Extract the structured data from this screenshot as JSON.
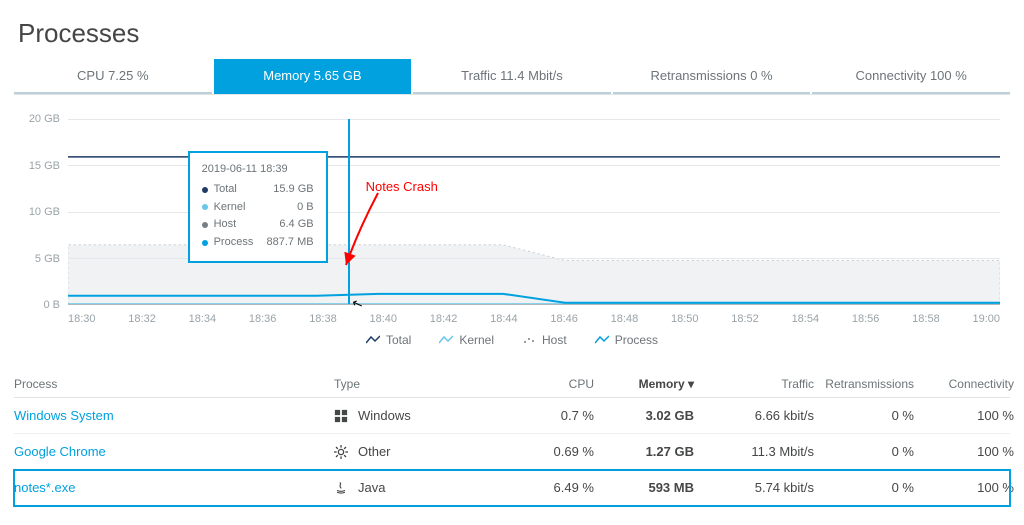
{
  "title": "Processes",
  "tabs": [
    {
      "label": "CPU 7.25 %"
    },
    {
      "label": "Memory 5.65 GB"
    },
    {
      "label": "Traffic 11.4 Mbit/s"
    },
    {
      "label": "Retransmissions 0 %"
    },
    {
      "label": "Connectivity 100 %"
    }
  ],
  "active_tab": 1,
  "chart_data": {
    "type": "line",
    "title": "",
    "xlabel": "",
    "ylabel": "",
    "ylim": [
      0,
      20
    ],
    "y_unit": "GB",
    "y_ticks": [
      "0 B",
      "5 GB",
      "10 GB",
      "15 GB",
      "20 GB"
    ],
    "categories": [
      "18:30",
      "18:32",
      "18:34",
      "18:36",
      "18:38",
      "18:40",
      "18:42",
      "18:44",
      "18:46",
      "18:48",
      "18:50",
      "18:52",
      "18:54",
      "18:56",
      "18:58",
      "19:00"
    ],
    "series": [
      {
        "name": "Total",
        "color": "#1f3a64",
        "values": [
          15.9,
          15.9,
          15.9,
          15.9,
          15.9,
          15.9,
          15.9,
          15.9,
          15.9,
          15.9,
          15.9,
          15.9,
          15.9,
          15.9,
          15.9,
          15.9
        ]
      },
      {
        "name": "Kernel",
        "color": "#66c7e8",
        "values": [
          0,
          0,
          0,
          0,
          0,
          0,
          0,
          0,
          0,
          0,
          0,
          0,
          0,
          0,
          0,
          0
        ]
      },
      {
        "name": "Host",
        "color": "#7a7f85",
        "values": [
          6.4,
          6.4,
          6.4,
          6.4,
          6.4,
          6.4,
          6.4,
          6.4,
          4.7,
          4.7,
          4.7,
          4.7,
          4.7,
          4.7,
          4.7,
          4.7
        ]
      },
      {
        "name": "Process",
        "color": "#00a1de",
        "values": [
          0.89,
          0.89,
          0.89,
          0.89,
          0.89,
          1.1,
          1.1,
          1.1,
          0.14,
          0.14,
          0.14,
          0.14,
          0.14,
          0.14,
          0.14,
          0.14
        ]
      }
    ],
    "tooltip": {
      "time": "2019-06-11 18:39",
      "items": [
        {
          "label": "Total",
          "value": "15.9 GB",
          "color": "#1f3a64"
        },
        {
          "label": "Kernel",
          "value": "0 B",
          "color": "#66c7e8"
        },
        {
          "label": "Host",
          "value": "6.4 GB",
          "color": "#7a7f85"
        },
        {
          "label": "Process",
          "value": "887.7 MB",
          "color": "#00a1de"
        }
      ],
      "x_index_fraction": 0.3
    },
    "annotation": {
      "text": "Notes Crash",
      "color": "#ff0000"
    }
  },
  "legend": [
    "Total",
    "Kernel",
    "Host",
    "Process"
  ],
  "table": {
    "columns": [
      "Process",
      "Type",
      "CPU",
      "Memory ▾",
      "Traffic",
      "Retransmissions",
      "Connectivity"
    ],
    "sort_col": 3,
    "rows": [
      {
        "process": "Windows System",
        "type": "Windows",
        "type_icon": "windows",
        "cpu": "0.7 %",
        "memory": "3.02 GB",
        "traffic": "6.66 kbit/s",
        "retrans": "0 %",
        "conn": "100 %",
        "selected": false
      },
      {
        "process": "Google Chrome",
        "type": "Other",
        "type_icon": "gear",
        "cpu": "0.69 %",
        "memory": "1.27 GB",
        "traffic": "11.3 Mbit/s",
        "retrans": "0 %",
        "conn": "100 %",
        "selected": false
      },
      {
        "process": "notes*.exe",
        "type": "Java",
        "type_icon": "java",
        "cpu": "6.49 %",
        "memory": "593 MB",
        "traffic": "5.74 kbit/s",
        "retrans": "0 %",
        "conn": "100 %",
        "selected": true
      }
    ]
  }
}
